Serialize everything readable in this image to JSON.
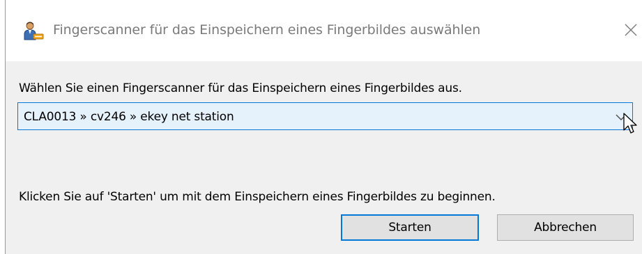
{
  "window": {
    "title": "Fingerscanner für das Einspeichern eines Fingerbildes auswählen",
    "icon": "user-fingerprint-icon",
    "close_icon": "close-icon"
  },
  "content": {
    "prompt": "Wählen Sie einen Fingerscanner für das Einspeichern eines Fingerbildes aus.",
    "scanner_select": {
      "value": "CLA0013 » cv246 » ekey net station",
      "arrow_icon": "chevron-down-icon"
    },
    "hint": "Klicken Sie auf 'Starten' um mit dem Einspeichern eines Fingerbildes zu beginnen."
  },
  "buttons": {
    "start_label": "Starten",
    "cancel_label": "Abbrechen"
  },
  "colors": {
    "accent": "#0078d7",
    "dialog_background": "#f0f0f0",
    "combo_hover_background": "#e5f1fb",
    "button_background": "#e1e1e1"
  }
}
